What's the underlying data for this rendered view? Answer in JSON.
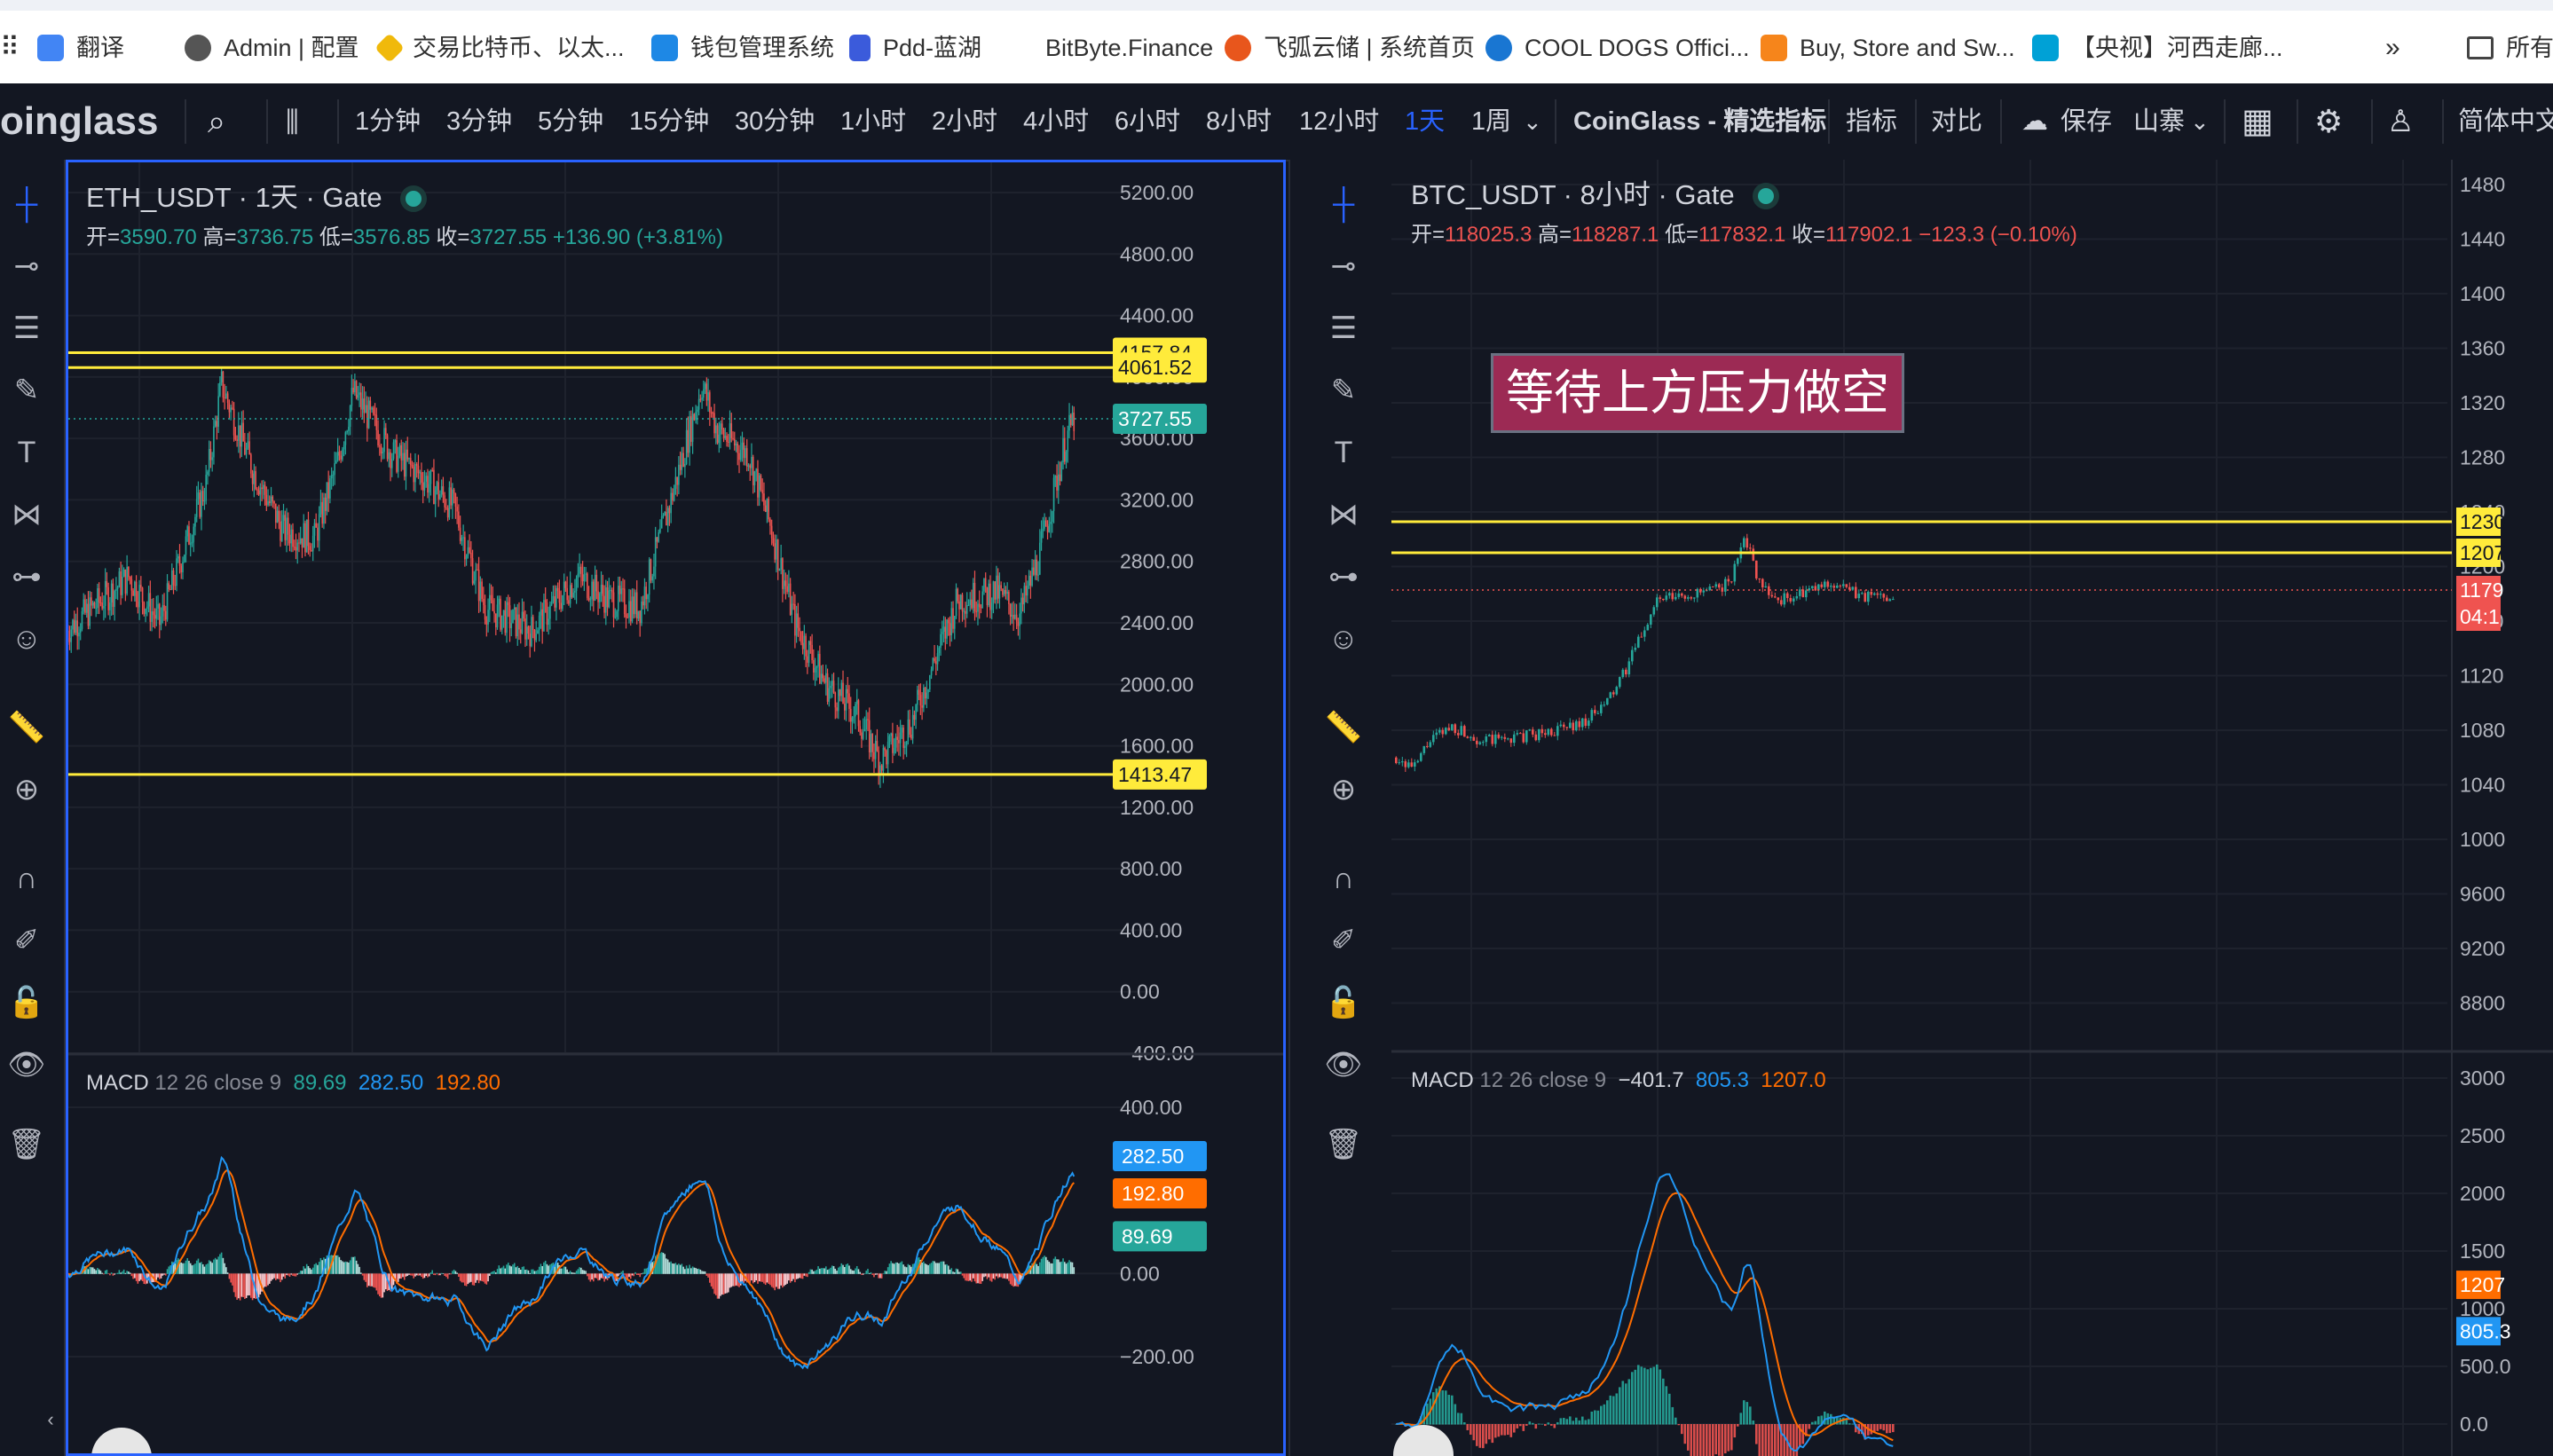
{
  "bookmarks": [
    {
      "label": "翻译",
      "icon": "translate-icon",
      "color": "#4285f4"
    },
    {
      "label": "Admin | 配置",
      "icon": "globe-icon",
      "color": "#555555"
    },
    {
      "label": "交易比特币、以太...",
      "icon": "binance-icon",
      "color": "#f0b90b"
    },
    {
      "label": "钱包管理系统",
      "icon": "wallet-icon",
      "color": "#1e88e5"
    },
    {
      "label": "Pdd-蓝湖",
      "icon": "lanhu-icon",
      "color": "#3b5bdb"
    },
    {
      "label": "BitByte.Finance",
      "icon": "",
      "color": ""
    },
    {
      "label": "飞弧云储 | 系统首页",
      "icon": "feihu-icon",
      "color": "#e8561c"
    },
    {
      "label": "COOL DOGS Offici...",
      "icon": "cooldogs-icon",
      "color": "#1976d2"
    },
    {
      "label": "Buy, Store and Sw...",
      "icon": "metamask-icon",
      "color": "#f6851b"
    },
    {
      "label": "【央视】河西走廊...",
      "icon": "bilibili-icon",
      "color": "#00a1d6"
    },
    {
      "label": "所有",
      "icon": "folder-icon",
      "color": "#444444"
    }
  ],
  "toolbar": {
    "logo": "oinglass",
    "intervals": [
      "1分钟",
      "3分钟",
      "5分钟",
      "15分钟",
      "30分钟",
      "1小时",
      "2小时",
      "4小时",
      "6小时",
      "8小时",
      "12小时",
      "1天",
      "1周"
    ],
    "active_interval": "1天",
    "indicator_set": "CoinGlass - 精选指标",
    "indicators": "指标",
    "compare": "对比",
    "save": "保存",
    "altcoin": "山寨",
    "language": "简体中文"
  },
  "left_chart": {
    "title": "ETH_USDT · 1天 · Gate",
    "ohlc": {
      "o_label": "开=",
      "o": "3590.70",
      "h_label": "高=",
      "h": "3736.75",
      "l_label": "低=",
      "l": "3576.85",
      "c_label": "收=",
      "c": "3727.55",
      "change": "+136.90 (+3.81%)"
    },
    "price_axis": [
      "5200.00",
      "4800.00",
      "4400.00",
      "4000.00",
      "3600.00",
      "3200.00",
      "2800.00",
      "2400.00",
      "2000.00",
      "1600.00",
      "1200.00",
      "800.00",
      "400.00",
      "0.00",
      "−400.00"
    ],
    "levels": [
      {
        "price": 4157.84,
        "label": "4157.84"
      },
      {
        "price": 4061.52,
        "label": "4061.52"
      },
      {
        "price": 1413.47,
        "label": "1413.47"
      }
    ],
    "last_price": {
      "price": 3727.55,
      "label": "3727.55"
    },
    "macd": {
      "title": "MACD",
      "params": "12 26 close 9",
      "hist": "89.69",
      "macd": "282.50",
      "signal": "192.80",
      "axis": [
        "400.00",
        "0.00",
        "−200.00"
      ]
    }
  },
  "right_chart": {
    "title": "BTC_USDT · 8小时 · Gate",
    "ohlc": {
      "o_label": "开=",
      "o": "118025.3",
      "h_label": "高=",
      "h": "118287.1",
      "l_label": "低=",
      "l": "117832.1",
      "c_label": "收=",
      "c": "117902.1",
      "change": "−123.3 (−0.10%)"
    },
    "price_axis": [
      "1480",
      "1440",
      "1400",
      "1360",
      "1320",
      "1280",
      "1240",
      "1200",
      "1160",
      "1120",
      "1080",
      "1040",
      "1000",
      "9600",
      "9200",
      "8800"
    ],
    "levels": [
      {
        "label": "1230"
      },
      {
        "label": "1207"
      }
    ],
    "last_price": {
      "label": "1179",
      "countdown": "04:1"
    },
    "annotation": "等待上方压力做空",
    "macd": {
      "title": "MACD",
      "params": "12 26 close 9",
      "hist": "−401.7",
      "macd": "805.3",
      "signal": "1207.0",
      "axis": [
        "3000",
        "2500",
        "2000",
        "1500",
        "1000",
        "500.0",
        "0.0"
      ],
      "badges": {
        "signal": "1207",
        "macd": "805.3"
      }
    }
  },
  "colors": {
    "bg": "#131722",
    "up": "#26a69a",
    "down": "#ef5350",
    "level": "#ffeb3b",
    "macd_line": "#2196f3",
    "signal_line": "#ff6d00",
    "accent": "#2962ff"
  }
}
